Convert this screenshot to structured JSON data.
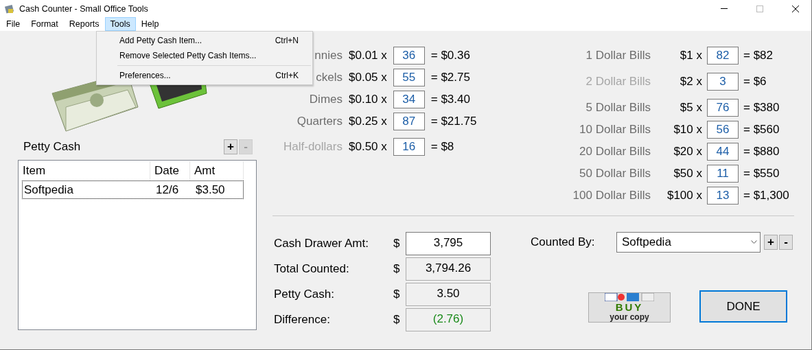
{
  "window": {
    "title": "Cash Counter - Small Office Tools"
  },
  "menu": [
    {
      "label": "File",
      "selected": false
    },
    {
      "label": "Format",
      "selected": false
    },
    {
      "label": "Reports",
      "selected": false
    },
    {
      "label": "Tools",
      "selected": true
    },
    {
      "label": "Help",
      "selected": false
    }
  ],
  "dropdown": [
    {
      "kind": "item",
      "label": "Add Petty Cash Item...",
      "shortcut": "Ctrl+N"
    },
    {
      "kind": "item",
      "label": "Remove Selected Petty Cash Items..."
    },
    {
      "kind": "separator"
    },
    {
      "kind": "item",
      "label": "Preferences...",
      "shortcut": "Ctrl+K"
    }
  ],
  "coins": [
    {
      "label": "nnies",
      "disabled": false,
      "price": "$0.01 x",
      "count": "36",
      "total": "= $0.36"
    },
    {
      "label": "ckels",
      "disabled": false,
      "price": "$0.05 x",
      "count": "55",
      "total": "= $2.75"
    },
    {
      "label": "Dimes",
      "disabled": false,
      "price": "$0.10 x",
      "count": "34",
      "total": "= $3.40"
    },
    {
      "label": "Quarters",
      "disabled": false,
      "price": "$0.25 x",
      "count": "87",
      "total": "= $21.75"
    },
    {
      "label": "Half-dollars",
      "disabled": true,
      "price": "$0.50 x",
      "count": "16",
      "total": "= $8"
    }
  ],
  "bills": [
    {
      "label": "1 Dollar Bills",
      "disabled": false,
      "price": "$1 x",
      "count": "82",
      "total": "= $82"
    },
    {
      "label": "2 Dollar Bills",
      "disabled": true,
      "price": "$2 x",
      "count": "3",
      "total": "= $6"
    },
    {
      "label": "5 Dollar Bills",
      "disabled": false,
      "price": "$5 x",
      "count": "76",
      "total": "= $380"
    },
    {
      "label": "10 Dollar Bills",
      "disabled": false,
      "price": "$10 x",
      "count": "56",
      "total": "= $560"
    },
    {
      "label": "20 Dollar Bills",
      "disabled": false,
      "price": "$20 x",
      "count": "44",
      "total": "= $880"
    },
    {
      "label": "50 Dollar Bills",
      "disabled": false,
      "price": "$50 x",
      "count": "11",
      "total": "= $550"
    },
    {
      "label": "100 Dollar Bills",
      "disabled": false,
      "price": "$100 x",
      "count": "13",
      "total": "= $1,300"
    }
  ],
  "petty_cash": {
    "title": "Petty Cash",
    "add_button": {
      "label": "+",
      "disabled": false
    },
    "remove_button": {
      "label": "-",
      "disabled": true
    },
    "columns": [
      "Item",
      "Date",
      "Amt"
    ],
    "rows": [
      {
        "cells": [
          "Softpedia",
          "12/6",
          "$3.50"
        ],
        "selected": true
      }
    ]
  },
  "summary": [
    {
      "kind": "input",
      "label": "Cash Drawer Amt:",
      "currency": "$",
      "value": "3,795"
    },
    {
      "kind": "readonly",
      "label": "Total Counted:",
      "currency": "$",
      "value": "3,794.26"
    },
    {
      "kind": "readonly",
      "label": "Petty Cash:",
      "currency": "$",
      "value": "3.50"
    },
    {
      "kind": "difference",
      "label": "Difference:",
      "currency": "$",
      "value": "(2.76)"
    }
  ],
  "counted_by": {
    "label": "Counted By:",
    "value": "Softpedia",
    "add_button": "+",
    "remove_button": "-"
  },
  "buy_button": {
    "line1": "BUY",
    "line2": "your copy"
  },
  "done_button": "DONE"
}
